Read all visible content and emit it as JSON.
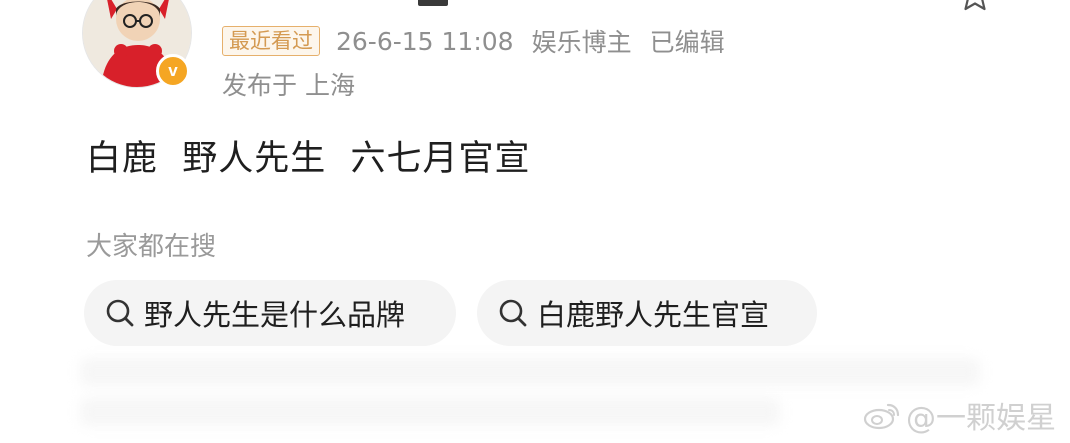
{
  "post_header": {
    "username": "",
    "recent_badge": "最近看过",
    "timestamp": "26-6-15 11:08",
    "author_type": "娱乐博主",
    "edited_label": "已编辑",
    "location": "发布于 上海",
    "verified_mark": "v"
  },
  "post": {
    "text": "白鹿  野人先生  六七月官宣"
  },
  "trending_search": {
    "title": "大家都在搜",
    "chips": [
      {
        "label": "野人先生是什么品牌",
        "icon": "search-icon"
      },
      {
        "label": "白鹿野人先生官宣",
        "icon": "search-icon"
      }
    ]
  },
  "watermark": {
    "text": "@一颗娱星",
    "icon": "weibo-logo-icon"
  },
  "colors": {
    "username": "#e8893a",
    "badge_border": "#e6b06c",
    "meta_text": "#8f8f8f",
    "chip_bg": "#f4f4f4",
    "verified": "#f5a623"
  }
}
